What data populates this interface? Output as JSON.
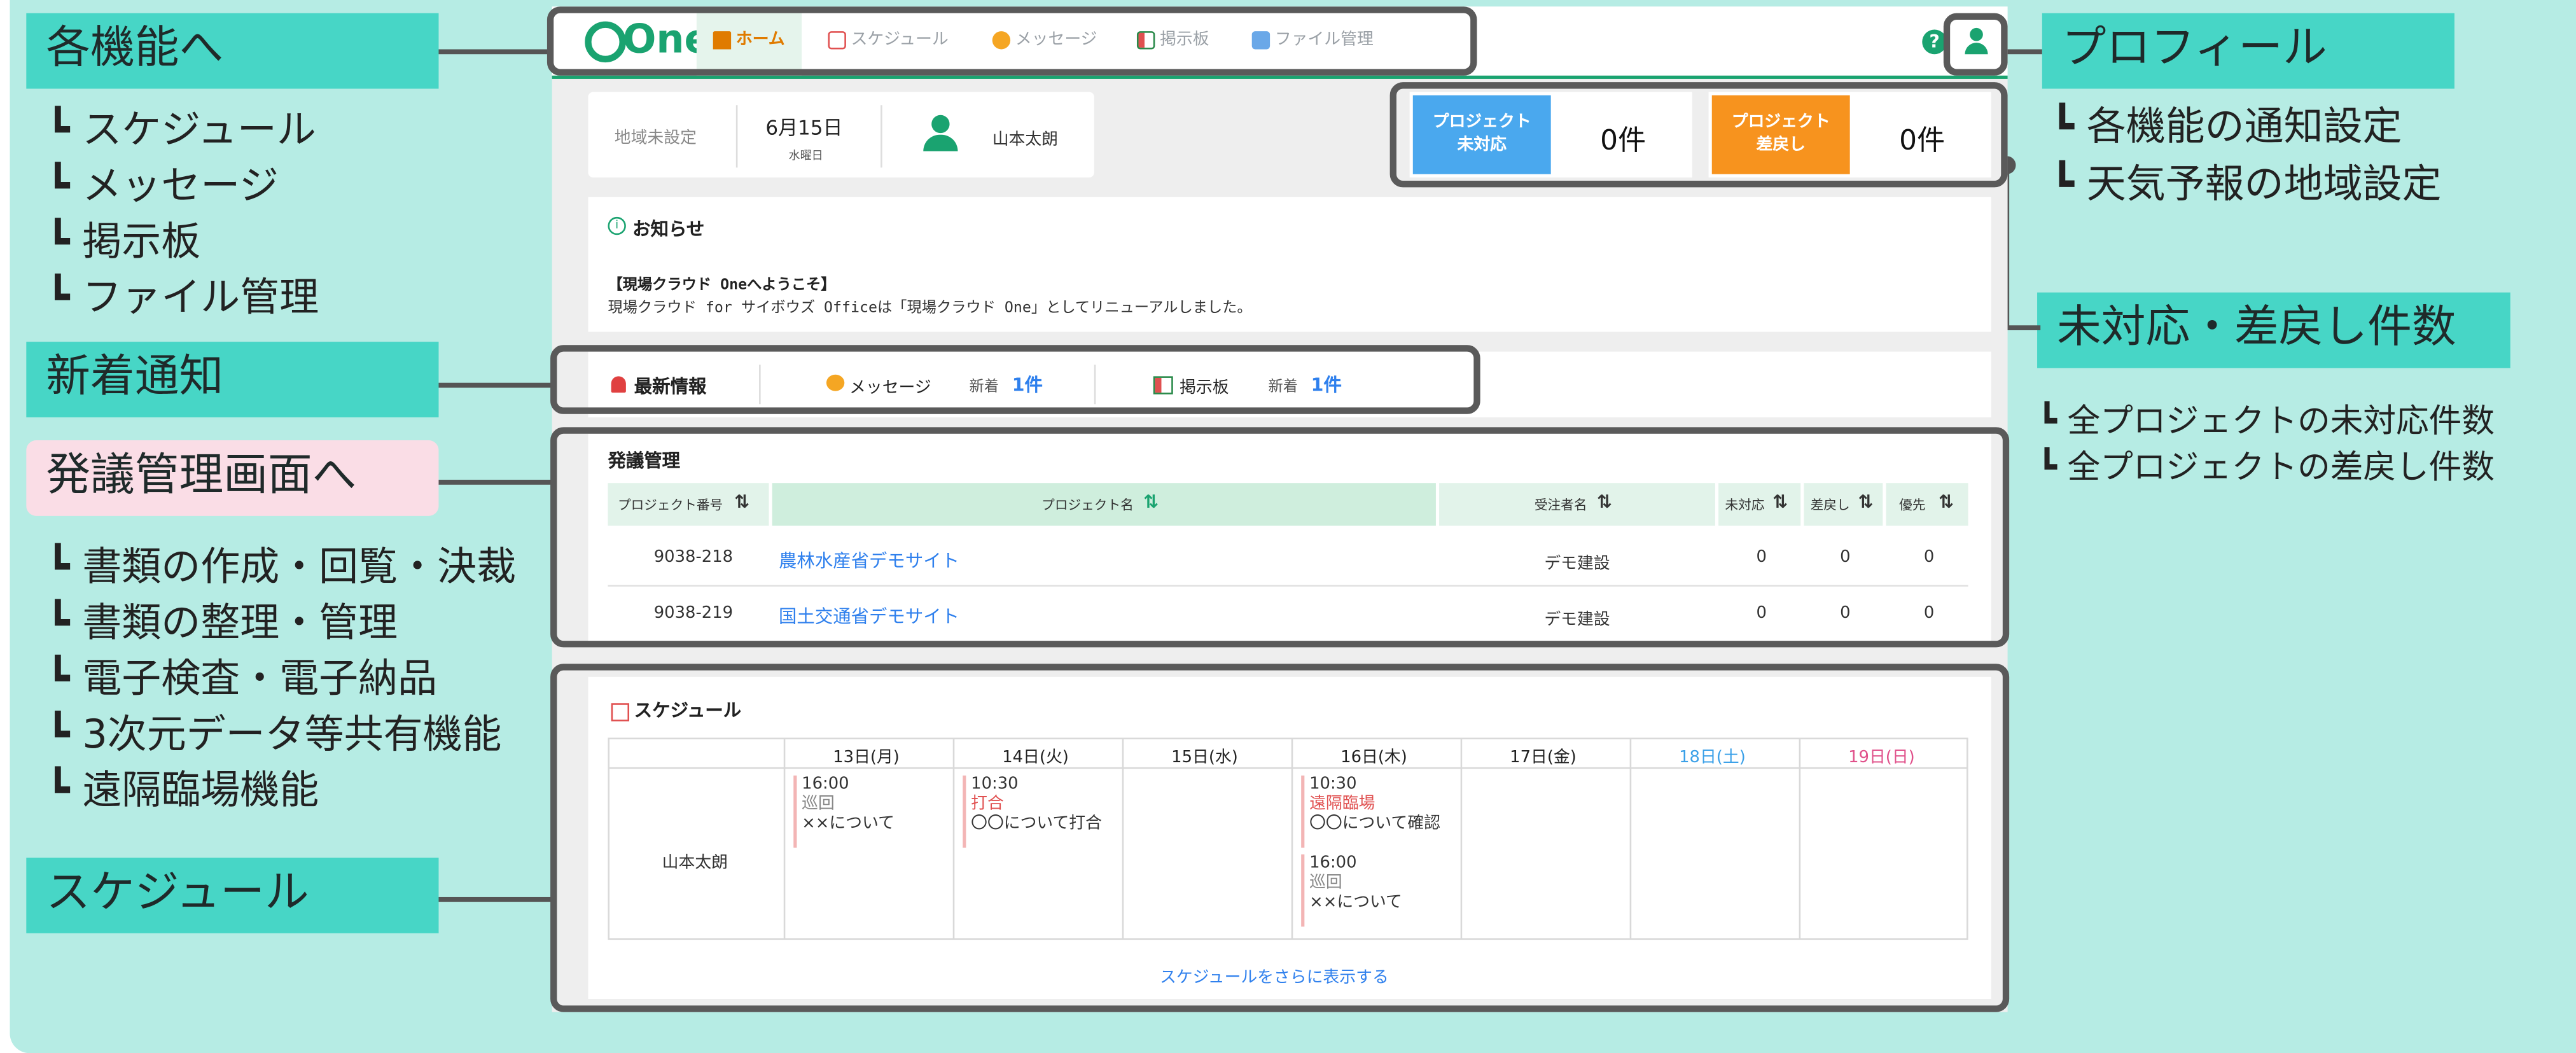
{
  "callouts": {
    "features": {
      "title": "各機能へ",
      "items": [
        "┗ スケジュール",
        "┗ メッセージ",
        "┗ 掲示板",
        "┗ ファイル管理"
      ]
    },
    "news": {
      "title": "新着通知"
    },
    "hatsugi": {
      "title": "発議管理画面へ",
      "items": [
        "┗ 書類の作成・回覧・決裁",
        "┗ 書類の整理・管理",
        "┗ 電子検査・電子納品",
        "┗ 3次元データ等共有機能",
        "┗ 遠隔臨場機能"
      ]
    },
    "schedule": {
      "title": "スケジュール"
    },
    "profile": {
      "title": "プロフィール",
      "items": [
        "┗ 各機能の通知設定",
        "┗ 天気予報の地域設定"
      ]
    },
    "counts": {
      "title": "未対応・差戻し件数",
      "items": [
        "┗ 全プロジェクトの未対応件数",
        "┗ 全プロジェクトの差戻し件数"
      ]
    }
  },
  "topbar": {
    "logo": "One",
    "nav": [
      {
        "label": "ホーム",
        "icon": "home-icon",
        "active": true
      },
      {
        "label": "スケジュール",
        "icon": "calendar-icon"
      },
      {
        "label": "メッセージ",
        "icon": "message-icon"
      },
      {
        "label": "掲示板",
        "icon": "board-icon"
      },
      {
        "label": "ファイル管理",
        "icon": "file-icon"
      }
    ],
    "help_icon": "?",
    "profile_icon": "user-icon"
  },
  "infobar": {
    "region": "地域未設定",
    "date": "6月15日",
    "weekday": "水曜日",
    "user": "山本太朗"
  },
  "stats": [
    {
      "label": "プロジェクト\n未対応",
      "value": "0件",
      "color": "#4aa8ee"
    },
    {
      "label": "プロジェクト\n差戻し",
      "value": "0件",
      "color": "#f7931e"
    }
  ],
  "notice": {
    "title": "お知らせ",
    "heading": "【現場クラウド Oneへようこそ】",
    "body": "現場クラウド for サイボウズ Officeは「現場クラウド One」としてリニューアルしました。"
  },
  "latest": {
    "title": "最新情報",
    "items": [
      {
        "label": "メッセージ",
        "new_label": "新着",
        "count": "1件"
      },
      {
        "label": "掲示板",
        "new_label": "新着",
        "count": "1件"
      }
    ]
  },
  "hatsugi_panel": {
    "title": "発議管理",
    "columns": [
      "プロジェクト番号",
      "プロジェクト名",
      "受注者名",
      "未対応",
      "差戻し",
      "優先"
    ],
    "rows": [
      {
        "no": "9038-218",
        "name": "農林水産省デモサイト",
        "contractor": "デモ建設",
        "pending": "0",
        "returned": "0",
        "priority": "0"
      },
      {
        "no": "9038-219",
        "name": "国土交通省デモサイト",
        "contractor": "デモ建設",
        "pending": "0",
        "returned": "0",
        "priority": "0"
      }
    ]
  },
  "schedule_panel": {
    "title": "スケジュール",
    "days": [
      "13日(月)",
      "14日(火)",
      "15日(水)",
      "16日(木)",
      "17日(金)",
      "18日(土)",
      "19日(日)"
    ],
    "person": "山本太朗",
    "events": {
      "mon": [
        {
          "time": "16:00",
          "type": "巡回",
          "desc": "××について"
        }
      ],
      "tue": [
        {
          "time": "10:30",
          "type": "打合",
          "desc": "〇〇について打合"
        }
      ],
      "thu": [
        {
          "time": "10:30",
          "type": "遠隔臨場",
          "desc": "〇〇について確認"
        },
        {
          "time": "16:00",
          "type": "巡回",
          "desc": "××について"
        }
      ]
    },
    "more": "スケジュールをさらに表示する"
  }
}
